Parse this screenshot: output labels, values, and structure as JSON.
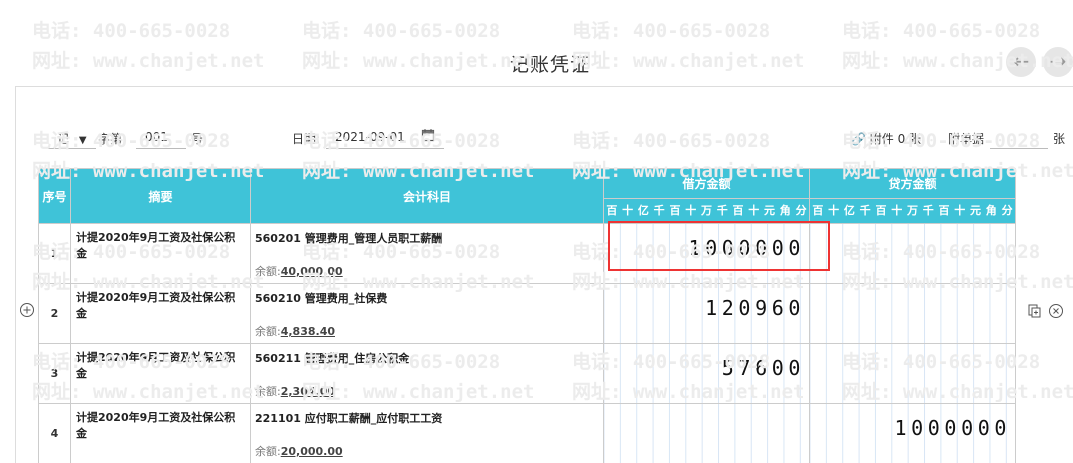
{
  "title": "记账凭证",
  "nav": {
    "prev": "←",
    "next": "→"
  },
  "header": {
    "voucher_word": "记",
    "word_suffix": "字第",
    "number": "001",
    "number_suffix": "号",
    "date_label": "日期:",
    "date": "2021-09-01",
    "attachment": "附件 0 张",
    "attachment_doc_label": "附单据",
    "attachment_unit": "张"
  },
  "columns": {
    "seq": "序号",
    "summary": "摘要",
    "account": "会计科目",
    "debit": "借方金额",
    "credit": "贷方金额",
    "digit_units": [
      "百",
      "十",
      "亿",
      "千",
      "百",
      "十",
      "万",
      "千",
      "百",
      "十",
      "元",
      "角",
      "分"
    ]
  },
  "rows": [
    {
      "seq": "1",
      "summary": "计提2020年9月工资及社保公积金",
      "account": "560201 管理费用_管理人员职工薪酬",
      "balance_label": "余额:",
      "balance": "40,000.00",
      "debit": "1000000",
      "credit": ""
    },
    {
      "seq": "2",
      "summary": "计提2020年9月工资及社保公积金",
      "account": "560210 管理费用_社保费",
      "balance_label": "余额:",
      "balance": "4,838.40",
      "debit": "120960",
      "credit": ""
    },
    {
      "seq": "3",
      "summary": "计提2020年9月工资及社保公积金",
      "account": "560211 管理费用_住房公积金",
      "balance_label": "余额:",
      "balance": "2,304.00",
      "debit": "57600",
      "credit": ""
    },
    {
      "seq": "4",
      "summary": "计提2020年9月工资及社保公积金",
      "account": "221101 应付职工薪酬_应付职工工资",
      "balance_label": "余额:",
      "balance": "20,000.00",
      "debit": "",
      "credit": "1000000"
    }
  ],
  "watermark": {
    "phone": "电话: 400-665-0028",
    "site": "网址: www.chanjet.net"
  }
}
